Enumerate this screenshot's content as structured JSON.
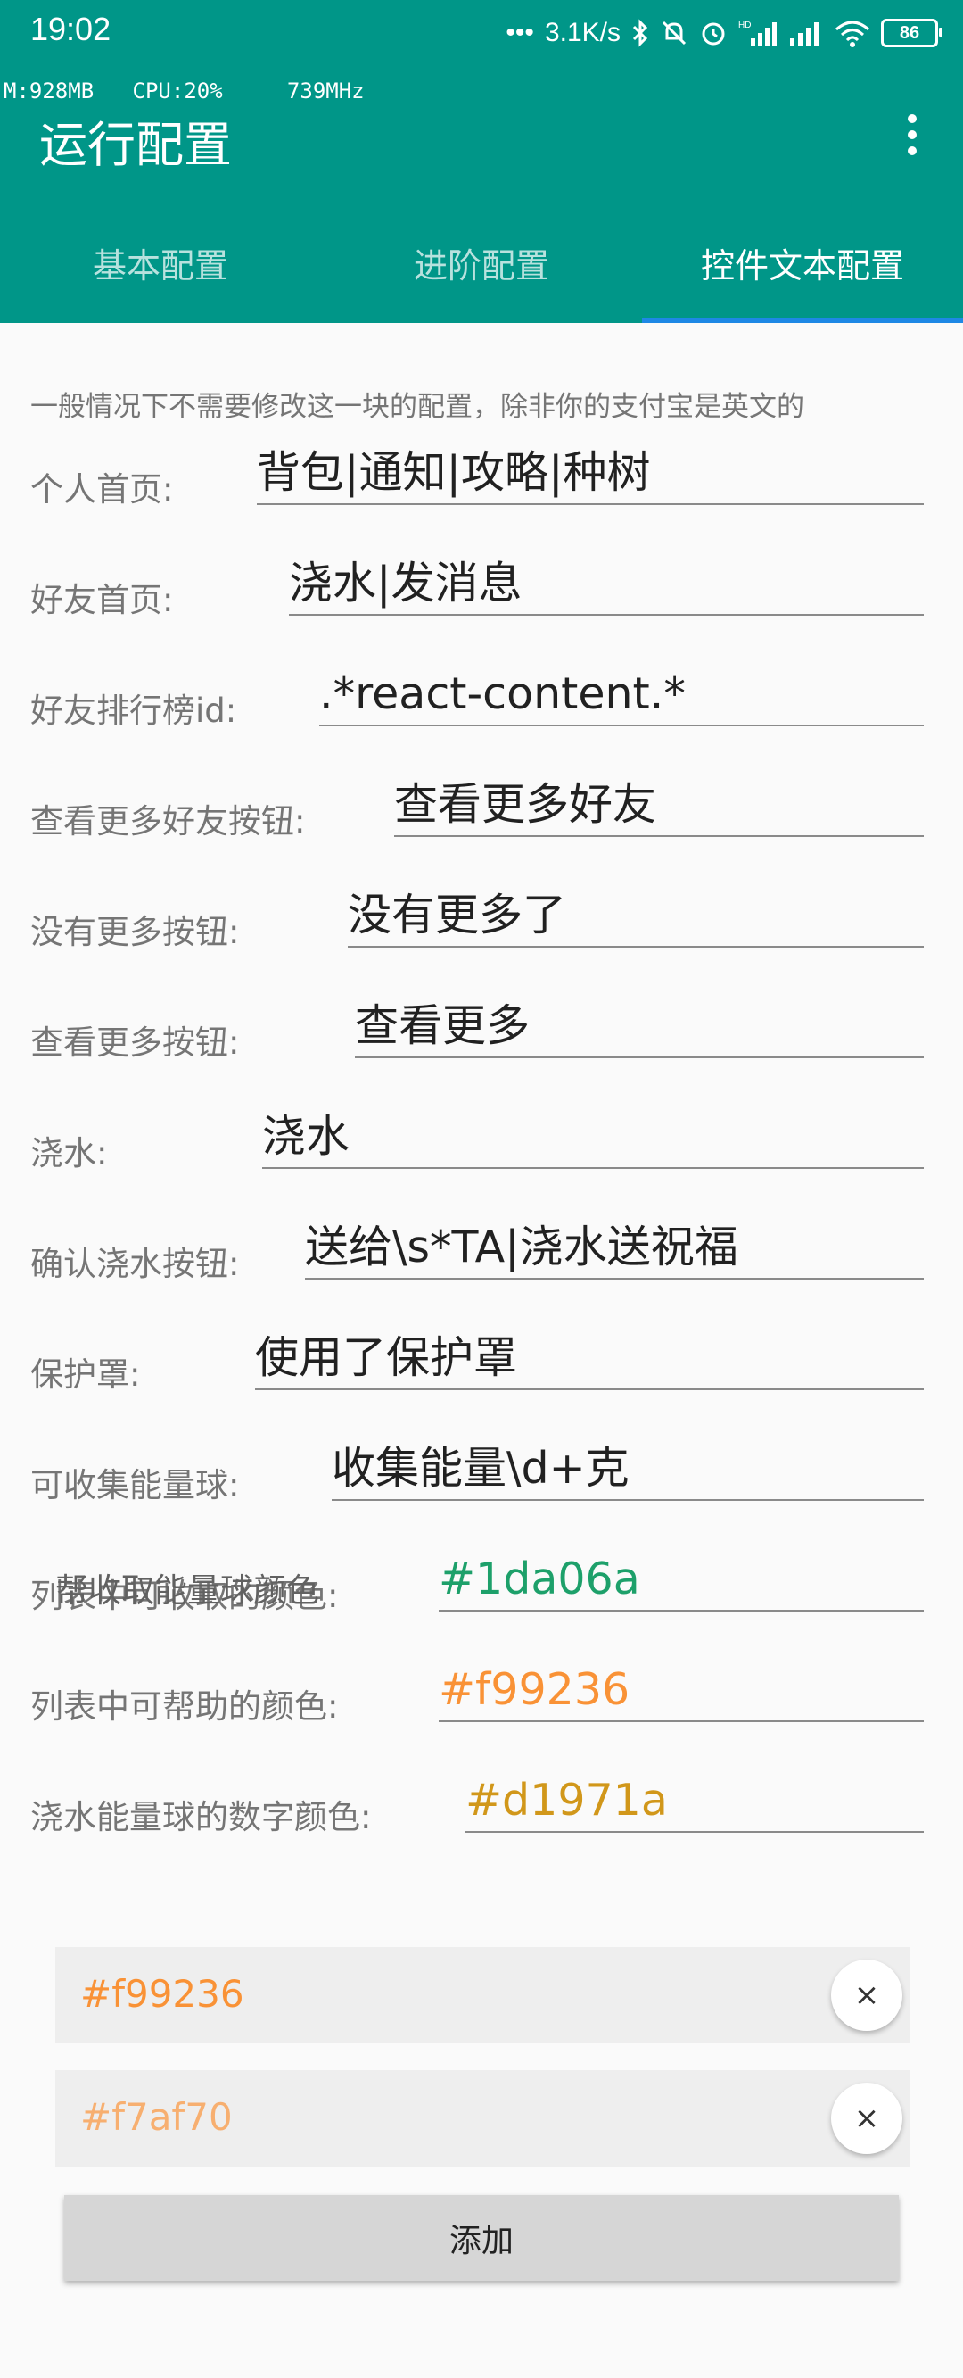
{
  "status": {
    "time": "19:02",
    "net_speed": "3.1K/s",
    "battery": "86"
  },
  "perf": {
    "mem": "M:928MB",
    "cpu": "CPU:20%",
    "freq": "739MHz"
  },
  "appbar": {
    "title": "运行配置"
  },
  "tabs": [
    {
      "label": "基本配置"
    },
    {
      "label": "进阶配置"
    },
    {
      "label": "控件文本配置"
    }
  ],
  "hint": "一般情况下不需要修改这一块的配置，除非你的支付宝是英文的",
  "fields": [
    {
      "label": "个人首页:",
      "value": "背包|通知|攻略|种树"
    },
    {
      "label": "好友首页:",
      "value": "浇水|发消息"
    },
    {
      "label": "好友排行榜id:",
      "value": ".*react-content.*"
    },
    {
      "label": "查看更多好友按钮:",
      "value": "查看更多好友"
    },
    {
      "label": "没有更多按钮:",
      "value": "没有更多了"
    },
    {
      "label": "查看更多按钮:",
      "value": "查看更多"
    },
    {
      "label": "浇水:",
      "value": "浇水"
    },
    {
      "label": "确认浇水按钮:",
      "value": "送给\\s*TA|浇水送祝福"
    },
    {
      "label": "保护罩:",
      "value": "使用了保护罩"
    },
    {
      "label": "可收集能量球:",
      "value": "收集能量\\d+克"
    },
    {
      "label": "列表中可收取的颜色:",
      "value": "#1da06a",
      "color": "#1da06a"
    },
    {
      "label": "列表中可帮助的颜色:",
      "value": "#f99236",
      "color": "#f99236"
    },
    {
      "label": "浇水能量球的数字颜色:",
      "value": "#d1971a",
      "color": "#d1971a"
    }
  ],
  "help_colors": {
    "title": "帮收取能量球颜色",
    "items": [
      {
        "value": "#f99236",
        "color": "#f99236"
      },
      {
        "value": "#f7af70",
        "color": "#f7af70"
      }
    ],
    "remove_glyph": "×",
    "add_label": "添加"
  },
  "colors": {
    "primary": "#009688",
    "tab_indicator": "#1e88e5"
  }
}
